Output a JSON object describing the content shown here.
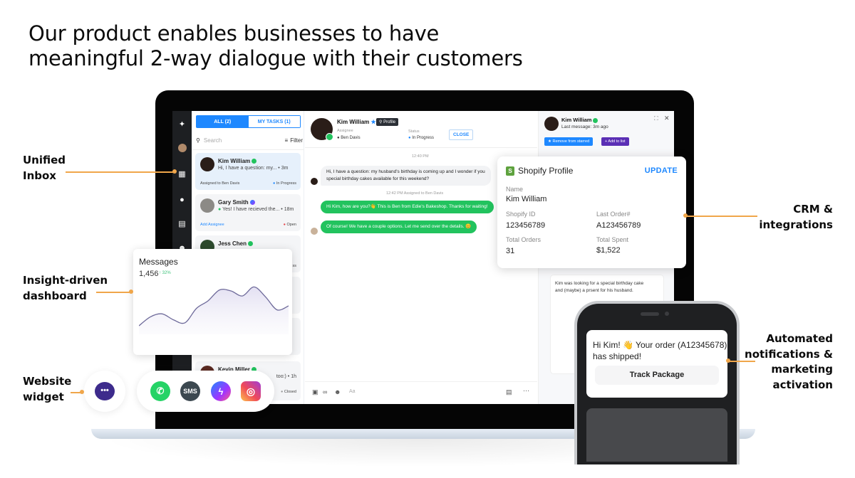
{
  "headline": {
    "line1": "Our product enables businesses to have",
    "line2": "meaningful 2-way dialogue with their customers"
  },
  "callouts": {
    "unified_inbox": [
      "Unified",
      "Inbox"
    ],
    "dashboard": [
      "Insight-driven",
      "dashboard"
    ],
    "website_widget": [
      "Website",
      "widget"
    ],
    "crm": [
      "CRM &",
      "integrations"
    ],
    "notifications": [
      "Automated",
      "notifications &",
      "marketing",
      "activation"
    ]
  },
  "colors": {
    "accent_orange": "#f0a64a",
    "primary_blue": "#1e88ff",
    "whatsapp_green": "#22c35e",
    "purple": "#5b2fb5"
  },
  "inbox": {
    "tabs": [
      {
        "label": "ALL (2)",
        "active": true
      },
      {
        "label": "MY TASKS (1)",
        "active": false
      }
    ],
    "search_placeholder": "Search",
    "filter_label": "Filter",
    "conversations": [
      {
        "name": "Kim William",
        "channel": "whatsapp",
        "preview": "Hi, I have a question: my... • 3m",
        "footer_left": "Assigned to Ben Davis",
        "status": "In Progress"
      },
      {
        "name": "Gary Smith",
        "channel": "messenger",
        "preview": "Yes! I have recieved the... • 18m",
        "footer_left": "Add Assignee",
        "status": "Open"
      },
      {
        "name": "Jess Chen",
        "channel": "whatsapp",
        "preview": "",
        "footer_left": "",
        "status": "ss"
      },
      {
        "name": "Kevin Miller",
        "channel": "whatsapp",
        "preview": "too:) • 1h",
        "footer_left": "",
        "status": "Closed"
      }
    ]
  },
  "chat": {
    "contact_name": "Kim William",
    "profile_label": "Profile",
    "assignee_label": "Assignee",
    "assignee_value": "Ben Davis",
    "status_label": "Status",
    "status_value": "In Progress",
    "close_label": "CLOSE",
    "messages": [
      {
        "type": "timestamp",
        "text": "12:40 PM"
      },
      {
        "type": "in",
        "lines": [
          "Hi, I have a question: my husband's birthday is coming up and I wonder if you",
          "special birthday cakes available for this weekend?"
        ]
      },
      {
        "type": "timestamp",
        "text": "12:42 PM   Assigned to Ben Davis"
      },
      {
        "type": "out",
        "lines": [
          "Hi Kim, how are you?👋 This is Ben from Edie's Bakeshop. Thanks for waiting!"
        ]
      },
      {
        "type": "out",
        "lines": [
          "Of course! We have a couple options. Let me send over the details. 😊"
        ]
      }
    ],
    "composer_placeholder": "Aa"
  },
  "contact_panel": {
    "name": "Kim William",
    "last_message": "Last message: 3m ago",
    "remove_starred_label": "Remove from starred",
    "add_to_list_label": "+ Add to list",
    "note": [
      "Kim was looking for a special birthday cake",
      "and (maybe) a prsent for his husband."
    ]
  },
  "shopify": {
    "title": "Shopify Profile",
    "update_label": "UPDATE",
    "fields": {
      "name_label": "Name",
      "name_value": "Kim William",
      "id_label": "Shopify ID",
      "id_value": "123456789",
      "last_order_label": "Last Order#",
      "last_order_value": "A123456789",
      "total_orders_label": "Total Orders",
      "total_orders_value": "31",
      "total_spent_label": "Total Spent",
      "total_spent_value": "$1,522"
    }
  },
  "messages_card": {
    "title": "Messages",
    "value": "1,456",
    "change": "↑ 32%",
    "chart_data": {
      "type": "area",
      "title": "Messages",
      "x": [
        0,
        1,
        2,
        3,
        4,
        5,
        6,
        7,
        8,
        9,
        10,
        11,
        12,
        13
      ],
      "values": [
        10,
        28,
        34,
        22,
        16,
        45,
        60,
        82,
        80,
        70,
        88,
        68,
        42,
        50
      ],
      "ylim": [
        0,
        100
      ]
    }
  },
  "widget": {
    "chat_bubble_icon": "chat-bubble-dots-icon",
    "channels": [
      {
        "name": "whatsapp-icon",
        "label": ""
      },
      {
        "name": "sms-icon",
        "label": "SMS"
      },
      {
        "name": "messenger-icon",
        "label": ""
      },
      {
        "name": "instagram-icon",
        "label": ""
      }
    ]
  },
  "phone": {
    "notification_text_1": "Hi Kim! 👋 Your order (A12345678)",
    "notification_text_2": "has shipped!",
    "track_label": "Track Package"
  }
}
